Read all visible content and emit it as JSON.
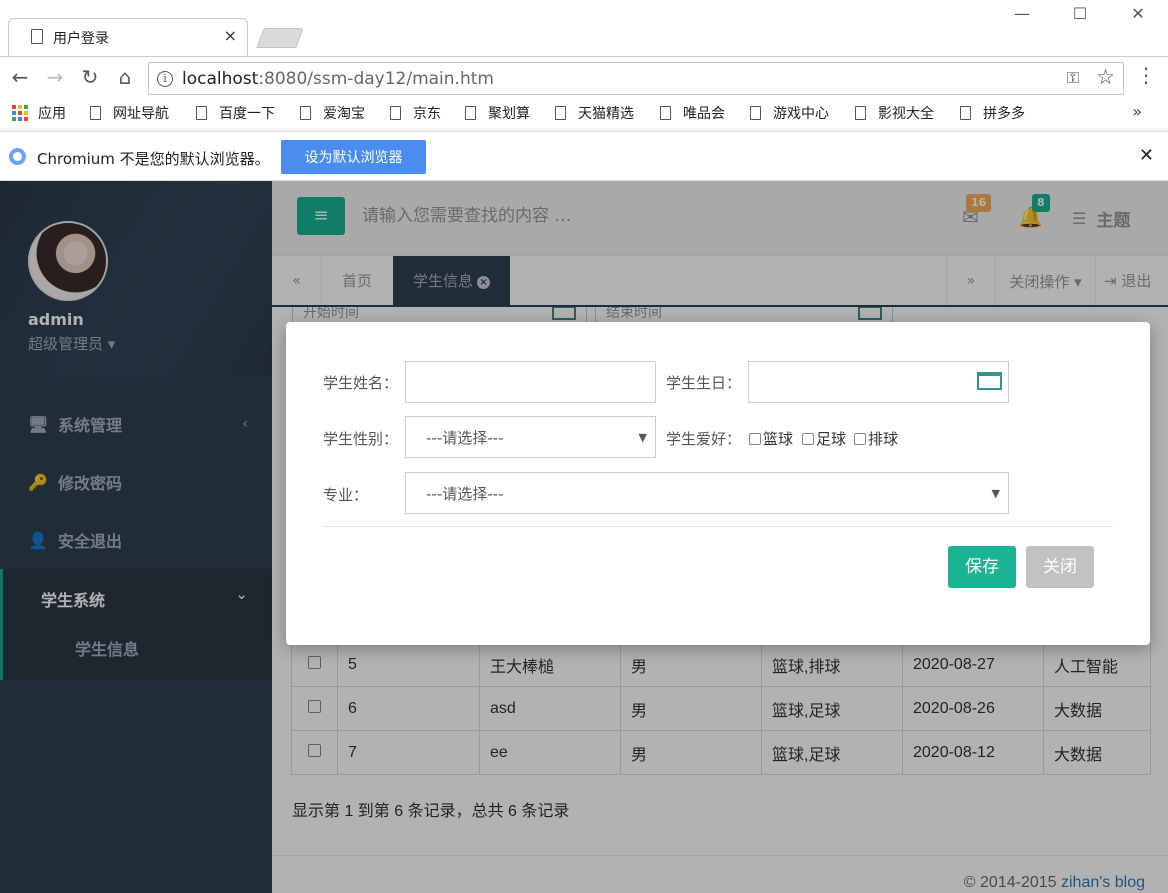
{
  "browser": {
    "tab_title": "用户登录",
    "tab_close": "×",
    "win_min": "—",
    "win_max": "☐",
    "win_close": "✕",
    "url_host": "localhost",
    "url_path": ":8080/ssm-day12/main.htm",
    "bookmarks": [
      "应用",
      "网址导航",
      "百度一下",
      "爱淘宝",
      "京东",
      "聚划算",
      "天猫精选",
      "唯品会",
      "游戏中心",
      "影视大全",
      "拼多多"
    ],
    "bookmarks_more": "»",
    "infobar_text": "Chromium 不是您的默认浏览器。",
    "infobar_button": "设为默认浏览器",
    "infobar_close": "✕"
  },
  "sidebar": {
    "username": "admin",
    "role": "超级管理员 ▾",
    "menu": [
      {
        "icon": "monitor-icon",
        "glyph": "🖥",
        "label": "系统管理",
        "chevron": "‹"
      },
      {
        "icon": "key-icon",
        "glyph": "🔑",
        "label": "修改密码"
      },
      {
        "icon": "user-times-icon",
        "glyph": "👤",
        "label": "安全退出"
      }
    ],
    "group_label": "学生系统",
    "group_chevron": "⌄",
    "sub_item": "学生信息"
  },
  "topbar": {
    "hamburger": "≡",
    "search_placeholder": "请输入您需要查找的内容 …",
    "mail_badge": "16",
    "bell_badge": "8",
    "theme_label": "主题"
  },
  "tabs": {
    "left_arrow": "«",
    "home": "首页",
    "active": "学生信息",
    "active_close": "×",
    "right_arrow": "»",
    "close_ops": "关闭操作 ▾",
    "logout": "退出"
  },
  "filters": {
    "start": "开始时间",
    "end": "结束时间"
  },
  "table": {
    "rows": [
      {
        "id": "5",
        "name": "王大棒槌",
        "gender": "男",
        "hobby": "篮球,排球",
        "birthday": "2020-08-27",
        "major": "人工智能"
      },
      {
        "id": "6",
        "name": "asd",
        "gender": "男",
        "hobby": "篮球,足球",
        "birthday": "2020-08-26",
        "major": "大数据"
      },
      {
        "id": "7",
        "name": "ee",
        "gender": "男",
        "hobby": "篮球,足球",
        "birthday": "2020-08-12",
        "major": "大数据"
      }
    ],
    "summary": "显示第 1 到第 6 条记录，总共 6 条记录"
  },
  "footer": {
    "copyright": "© 2014-2015 ",
    "link": "zihan's blog"
  },
  "modal": {
    "name_label": "学生姓名：",
    "name_value": "",
    "birthday_label": "学生生日：",
    "birthday_value": "",
    "gender_label": "学生性别：",
    "gender_selected": "---请选择---",
    "hobby_label": "学生爱好：",
    "hobbies": [
      "篮球",
      "足球",
      "排球"
    ],
    "major_label": "专业：",
    "major_selected": "---请选择---",
    "save_button": "保存",
    "close_button": "关闭"
  },
  "colors": {
    "accent": "#1ab394",
    "sidebar": "#2f4050",
    "primary_button": "#4b8cf0",
    "badge_warning": "#f8ac59"
  }
}
